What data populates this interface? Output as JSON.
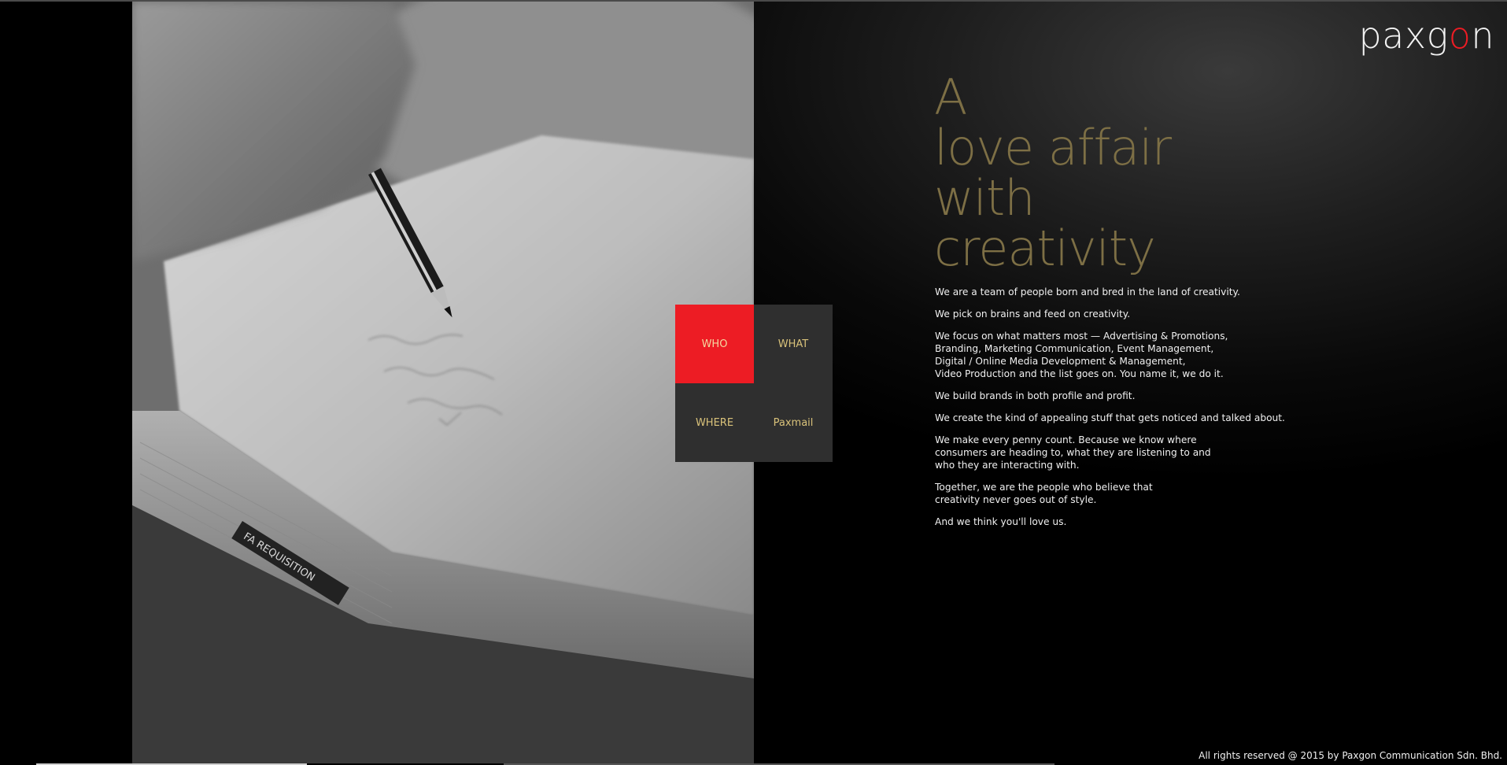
{
  "brand": {
    "logo_pre": "paxg",
    "logo_accent": "o",
    "logo_post": "n"
  },
  "hero": {
    "image": "grayscale-photo-hand-writing-with-pencil-on-paper-documents",
    "tag_text": "FA REQUISITION"
  },
  "nav": {
    "items": [
      {
        "label": "WHO",
        "active": true
      },
      {
        "label": "WHAT",
        "active": false
      },
      {
        "label": "WHERE",
        "active": false
      },
      {
        "label": "Paxmail",
        "active": false
      }
    ]
  },
  "headline": {
    "lines": [
      "A",
      "love affair",
      "with",
      "creativity"
    ]
  },
  "body": {
    "paragraphs": [
      "We are a team of people born and bred in the land of creativity.",
      "We pick on brains and feed on creativity.",
      "We focus on what matters most — Advertising & Promotions,\nBranding, Marketing Communication, Event Management,\nDigital / Online Media Development & Management,\nVideo Production and the list goes on. You name it, we do it.",
      "We build brands in both profile and profit.",
      "We create the kind of appealing stuff that gets noticed and talked about.",
      "We make every penny count. Because we know where\nconsumers are heading to, what they are listening to and\nwho they are interacting with.",
      "Together, we are the people who believe that\ncreativity never goes out of style.",
      "And we think you'll love us."
    ]
  },
  "footer": {
    "copyright": "All rights reserved @ 2015 by Paxgon Communication Sdn. Bhd."
  },
  "colors": {
    "accent_red": "#ed1c24",
    "headline_gold": "#7d6f45",
    "nav_text_gold": "#d9c27a",
    "nav_cell_gray": "#2f2f2f"
  }
}
